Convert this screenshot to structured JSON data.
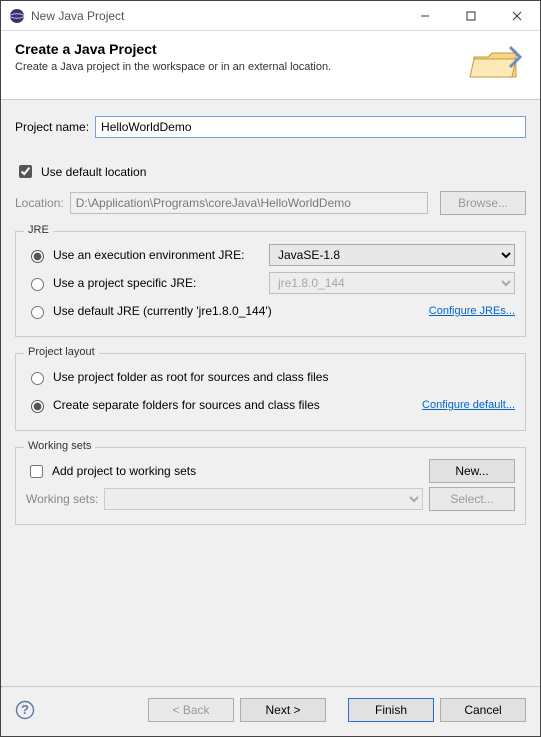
{
  "titlebar": {
    "text": "New Java Project"
  },
  "banner": {
    "title": "Create a Java Project",
    "subtitle": "Create a Java project in the workspace or in an external location."
  },
  "project_name": {
    "label": "Project name:",
    "value": "HelloWorldDemo"
  },
  "location": {
    "checkbox_label": "Use default location",
    "checked": true,
    "label": "Location:",
    "value": "D:\\Application\\Programs\\coreJava\\HelloWorldDemo",
    "browse": "Browse..."
  },
  "jre": {
    "legend": "JRE",
    "options": [
      {
        "label": "Use an execution environment JRE:",
        "select": "JavaSE-1.8",
        "enabled": true,
        "checked": true
      },
      {
        "label": "Use a project specific JRE:",
        "select": "jre1.8.0_144",
        "enabled": false,
        "checked": false
      },
      {
        "label": "Use default JRE (currently 'jre1.8.0_144')",
        "enabled": true,
        "checked": false
      }
    ],
    "configure_link": "Configure JREs..."
  },
  "layout": {
    "legend": "Project layout",
    "options": [
      {
        "label": "Use project folder as root for sources and class files",
        "checked": false
      },
      {
        "label": "Create separate folders for sources and class files",
        "checked": true
      }
    ],
    "configure_link": "Configure default..."
  },
  "working_sets": {
    "legend": "Working sets",
    "checkbox_label": "Add project to working sets",
    "checked": false,
    "new_btn": "New...",
    "label": "Working sets:",
    "select_btn": "Select..."
  },
  "footer": {
    "back": "< Back",
    "next": "Next >",
    "finish": "Finish",
    "cancel": "Cancel"
  }
}
